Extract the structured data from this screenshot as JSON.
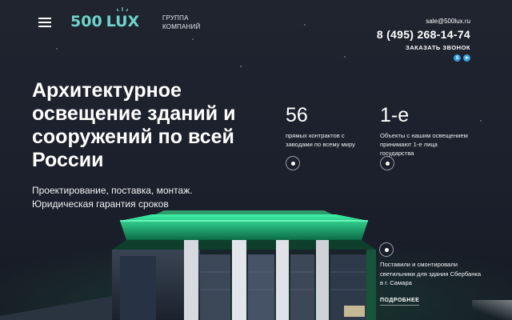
{
  "header": {
    "logo_num": "500",
    "logo_word": "LUX",
    "group_caption": "ГРУППА КОМПАНИЙ",
    "email": "sale@500lux.ru",
    "phone": "8 (495) 268-14-74",
    "callback_label": "ЗАКАЗАТЬ ЗВОНОК",
    "messengers": [
      {
        "icon": "skype-icon",
        "glyph": "S"
      },
      {
        "icon": "telegram-icon",
        "glyph": "➤"
      }
    ]
  },
  "hero": {
    "title": "Архитектурное освещение зданий и сооружений по всей России",
    "subtitle_line1": "Проектирование, поставка, монтаж.",
    "subtitle_line2": "Юридическая гарантия сроков"
  },
  "stats": [
    {
      "value": "56",
      "desc": "прямых контрактов с заводами по всему миру"
    },
    {
      "value": "1-е",
      "desc": "Объекты с нашим освещением принимают 1-е лица государства"
    }
  ],
  "project": {
    "text": "Поставили и смонтировали светильники для здания Сбербанка в г. Самара",
    "more_label": "ПОДРОБНЕЕ"
  },
  "colors": {
    "background": "#1d212e",
    "logo": "#6fd3c9",
    "building_glow": "#2fe29a",
    "text": "#ffffff"
  }
}
